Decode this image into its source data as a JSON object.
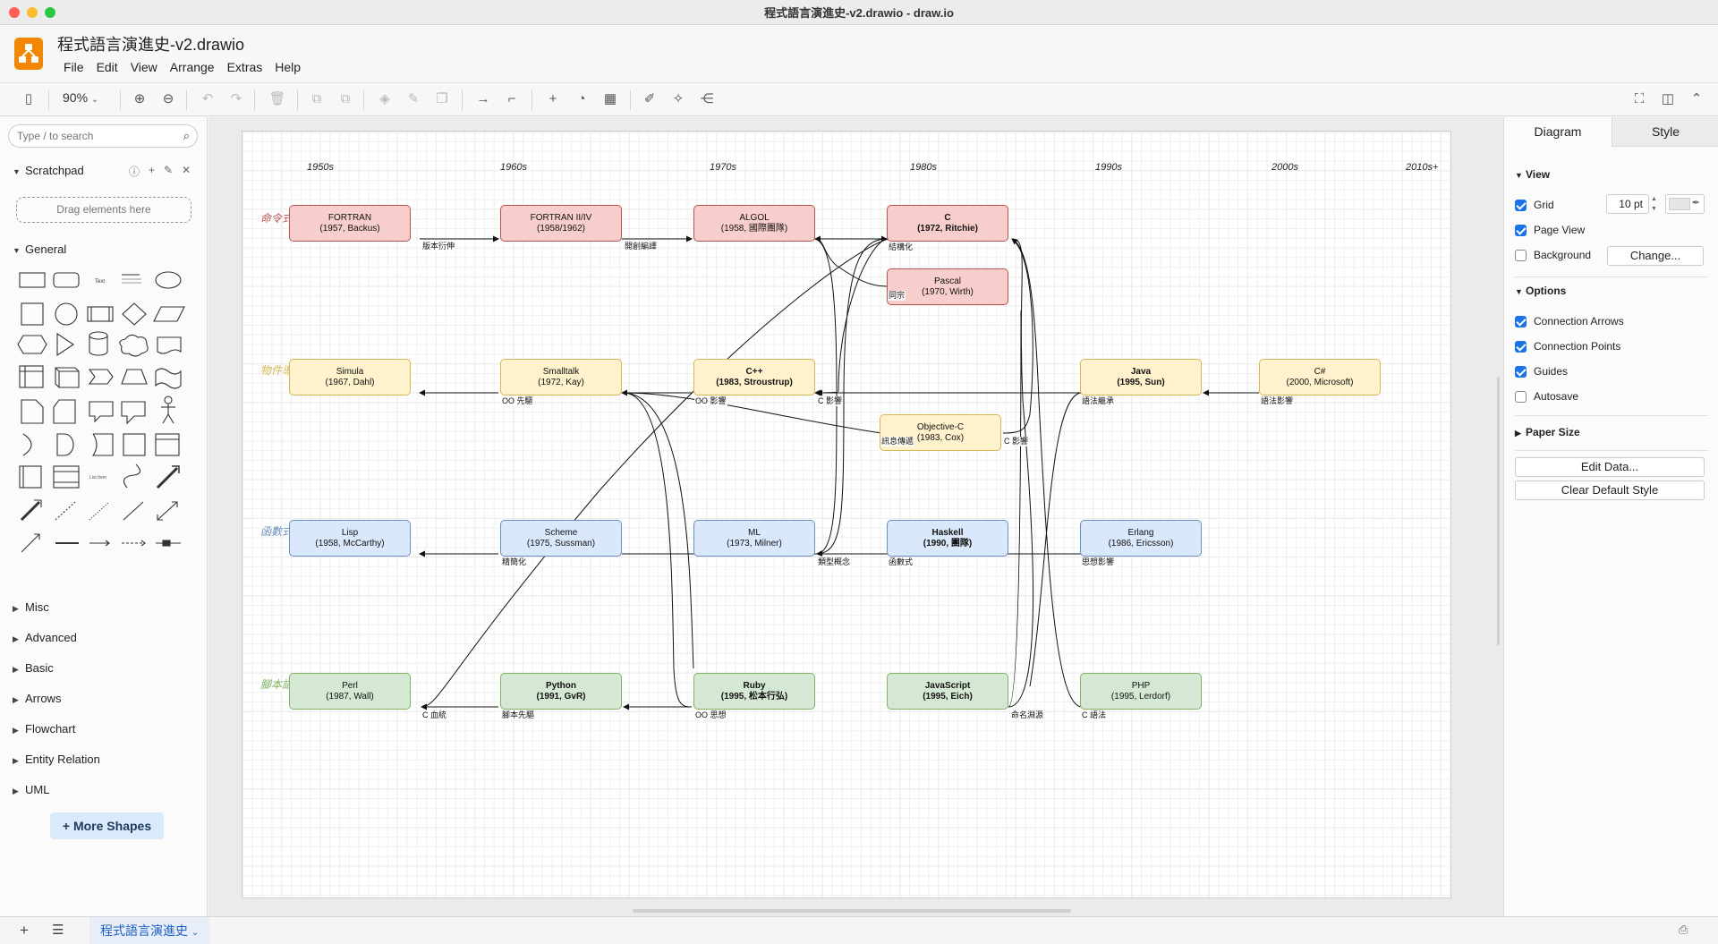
{
  "window": {
    "title": "程式語言演進史-v2.drawio - draw.io"
  },
  "app": {
    "doc_title": "程式語言演進史-v2.drawio",
    "menu": [
      "File",
      "Edit",
      "View",
      "Arrange",
      "Extras",
      "Help"
    ]
  },
  "toolbar": {
    "zoom": "90%"
  },
  "sidebar": {
    "search_placeholder": "Type / to search",
    "scratchpad": "Scratchpad",
    "drag_hint": "Drag elements here",
    "general": "General",
    "sections": [
      "Misc",
      "Advanced",
      "Basic",
      "Arrows",
      "Flowchart",
      "Entity Relation",
      "UML"
    ],
    "more_shapes": "More Shapes"
  },
  "diagram": {
    "eras": [
      "1950s",
      "1960s",
      "1970s",
      "1980s",
      "1990s",
      "2000s",
      "2010s+"
    ],
    "lanes": [
      {
        "label": "命令式",
        "color": "#b85450"
      },
      {
        "label": "物件導向",
        "color": "#d6b656"
      },
      {
        "label": "函數式",
        "color": "#6c8ebf"
      },
      {
        "label": "腳本語言",
        "color": "#82b366"
      }
    ],
    "nodes": [
      {
        "id": "fortran",
        "name": "FORTRAN",
        "sub": "(1957, Backus)",
        "bold": false
      },
      {
        "id": "fortran2",
        "name": "FORTRAN II/IV",
        "sub": "(1958/1962)",
        "bold": false
      },
      {
        "id": "algol",
        "name": "ALGOL",
        "sub": "(1958, 國際團隊)",
        "bold": false
      },
      {
        "id": "c",
        "name": "C",
        "sub": "(1972, Ritchie)",
        "bold": true
      },
      {
        "id": "pascal",
        "name": "Pascal",
        "sub": "(1970, Wirth)",
        "bold": false
      },
      {
        "id": "simula",
        "name": "Simula",
        "sub": "(1967, Dahl)",
        "bold": false
      },
      {
        "id": "smalltalk",
        "name": "Smalltalk",
        "sub": "(1972, Kay)",
        "bold": false
      },
      {
        "id": "cpp",
        "name": "C++",
        "sub": "(1983, Stroustrup)",
        "bold": true
      },
      {
        "id": "objc",
        "name": "Objective-C",
        "sub": "(1983, Cox)",
        "bold": false
      },
      {
        "id": "java",
        "name": "Java",
        "sub": "(1995, Sun)",
        "bold": true
      },
      {
        "id": "csharp",
        "name": "C#",
        "sub": "(2000, Microsoft)",
        "bold": false
      },
      {
        "id": "lisp",
        "name": "Lisp",
        "sub": "(1958, McCarthy)",
        "bold": false
      },
      {
        "id": "scheme",
        "name": "Scheme",
        "sub": "(1975, Sussman)",
        "bold": false
      },
      {
        "id": "ml",
        "name": "ML",
        "sub": "(1973, Milner)",
        "bold": false
      },
      {
        "id": "haskell",
        "name": "Haskell",
        "sub": "(1990, 團隊)",
        "bold": true
      },
      {
        "id": "erlang",
        "name": "Erlang",
        "sub": "(1986, Ericsson)",
        "bold": false
      },
      {
        "id": "perl",
        "name": "Perl",
        "sub": "(1987, Wall)",
        "bold": false
      },
      {
        "id": "python",
        "name": "Python",
        "sub": "(1991, GvR)",
        "bold": true
      },
      {
        "id": "ruby",
        "name": "Ruby",
        "sub": "(1995, 松本行弘)",
        "bold": true
      },
      {
        "id": "javascript",
        "name": "JavaScript",
        "sub": "(1995, Eich)",
        "bold": true
      },
      {
        "id": "php",
        "name": "PHP",
        "sub": "(1995, Lerdorf)",
        "bold": false
      }
    ],
    "edge_labels": [
      "版本衍伸",
      "開創編譯",
      "結構化",
      "同宗",
      "OO 先驅",
      "OO 影響",
      "C 影響",
      "訊息傳遞",
      "C 影響",
      "語法繼承",
      "語法影響",
      "精簡化",
      "類型概念",
      "函數式",
      "思想影響",
      "C 血統",
      "腳本先驅",
      "OO 思想",
      "命名淵源",
      "C 語法"
    ]
  },
  "format_panel": {
    "tabs": [
      "Diagram",
      "Style"
    ],
    "view": "View",
    "grid": "Grid",
    "grid_size": "10 pt",
    "page_view": "Page View",
    "background": "Background",
    "change": "Change...",
    "options": "Options",
    "connection_arrows": "Connection Arrows",
    "connection_points": "Connection Points",
    "guides": "Guides",
    "autosave": "Autosave",
    "paper_size": "Paper Size",
    "edit_data": "Edit Data...",
    "clear_style": "Clear Default Style"
  },
  "bottom": {
    "page_tab": "程式語言演進史"
  }
}
